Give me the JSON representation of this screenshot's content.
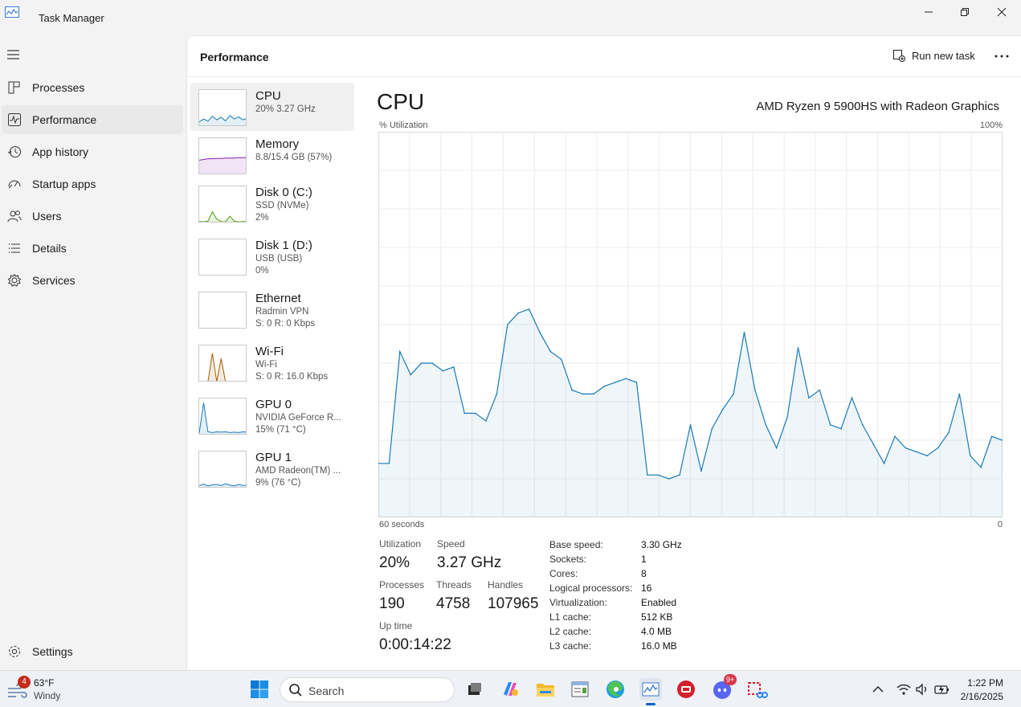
{
  "window": {
    "title": "Task Manager"
  },
  "sidebar": {
    "items": [
      {
        "label": "Processes",
        "icon": "processes-icon"
      },
      {
        "label": "Performance",
        "icon": "performance-icon"
      },
      {
        "label": "App history",
        "icon": "app-history-icon"
      },
      {
        "label": "Startup apps",
        "icon": "startup-apps-icon"
      },
      {
        "label": "Users",
        "icon": "users-icon"
      },
      {
        "label": "Details",
        "icon": "details-icon"
      },
      {
        "label": "Services",
        "icon": "services-icon"
      }
    ],
    "settings": "Settings"
  },
  "header": {
    "title": "Performance",
    "run_new_task": "Run new task"
  },
  "resources": [
    {
      "name": "CPU",
      "line1": "20%  3.27 GHz",
      "line2": "",
      "color": "#1a7ab8"
    },
    {
      "name": "Memory",
      "line1": "8.8/15.4 GB (57%)",
      "line2": "",
      "color": "#8b21a8"
    },
    {
      "name": "Disk 0 (C:)",
      "line1": "SSD (NVMe)",
      "line2": "2%",
      "color": "#4e9a06"
    },
    {
      "name": "Disk 1 (D:)",
      "line1": "USB (USB)",
      "line2": "0%",
      "color": "#4e9a06"
    },
    {
      "name": "Ethernet",
      "line1": "Radmin VPN",
      "line2": "S: 0  R: 0 Kbps",
      "color": "#a75a00"
    },
    {
      "name": "Wi-Fi",
      "line1": "Wi-Fi",
      "line2": "S: 0  R: 16.0 Kbps",
      "color": "#a75a00"
    },
    {
      "name": "GPU 0",
      "line1": "NVIDIA GeForce R...",
      "line2": "15%  (71 °C)",
      "color": "#1a7ab8"
    },
    {
      "name": "GPU 1",
      "line1": "AMD Radeon(TM) ...",
      "line2": "9%  (76 °C)",
      "color": "#1a7ab8"
    }
  ],
  "cpu": {
    "title": "CPU",
    "model": "AMD Ryzen 9 5900HS with Radeon Graphics",
    "util_label": "% Utilization",
    "max_label": "100%",
    "time_label": "60 seconds",
    "zero_label": "0",
    "stats": {
      "utilization_label": "Utilization",
      "utilization": "20%",
      "speed_label": "Speed",
      "speed": "3.27 GHz",
      "processes_label": "Processes",
      "processes": "190",
      "threads_label": "Threads",
      "threads": "4758",
      "handles_label": "Handles",
      "handles": "107965",
      "uptime_label": "Up time",
      "uptime": "0:00:14:22"
    },
    "specs": [
      {
        "k": "Base speed:",
        "v": "3.30 GHz"
      },
      {
        "k": "Sockets:",
        "v": "1"
      },
      {
        "k": "Cores:",
        "v": "8"
      },
      {
        "k": "Logical processors:",
        "v": "16"
      },
      {
        "k": "Virtualization:",
        "v": "Enabled"
      },
      {
        "k": "L1 cache:",
        "v": "512 KB"
      },
      {
        "k": "L2 cache:",
        "v": "4.0 MB"
      },
      {
        "k": "L3 cache:",
        "v": "16.0 MB"
      }
    ]
  },
  "chart_data": {
    "type": "area",
    "x": [
      60,
      59,
      58,
      57,
      56,
      55,
      54,
      53,
      52,
      51,
      50,
      49,
      48,
      47,
      46,
      45,
      44,
      43,
      42,
      41,
      40,
      39,
      38,
      37,
      36,
      35,
      34,
      33,
      32,
      31,
      30,
      29,
      28,
      27,
      26,
      25,
      24,
      23,
      22,
      21,
      20,
      19,
      18,
      17,
      16,
      15,
      14,
      13,
      12,
      11,
      10,
      9,
      8,
      7,
      6,
      5,
      4,
      3,
      2,
      1,
      0
    ],
    "values": [
      14,
      14,
      43,
      37,
      40,
      40,
      38,
      39,
      27,
      27,
      25,
      32,
      50,
      53,
      54,
      48,
      43,
      41,
      33,
      32,
      32,
      34,
      35,
      36,
      35,
      11,
      11,
      10,
      11,
      24,
      12,
      23,
      28,
      32,
      48,
      33,
      24,
      18,
      26,
      44,
      31,
      33,
      24,
      23,
      31,
      24,
      19,
      14,
      21,
      18,
      17,
      16,
      18,
      22,
      32,
      16,
      13,
      21,
      20
    ],
    "ylim": [
      0,
      100
    ],
    "xlabel": "60 seconds",
    "ylabel": "% Utilization",
    "grid": true,
    "color": "#1a7ab8"
  },
  "taskbar": {
    "weather_temp": "63°F",
    "weather_desc": "Windy",
    "weather_badge": "4",
    "search": "Search",
    "discord_badge": "9+",
    "time": "1:22 PM",
    "date": "2/16/2025"
  }
}
